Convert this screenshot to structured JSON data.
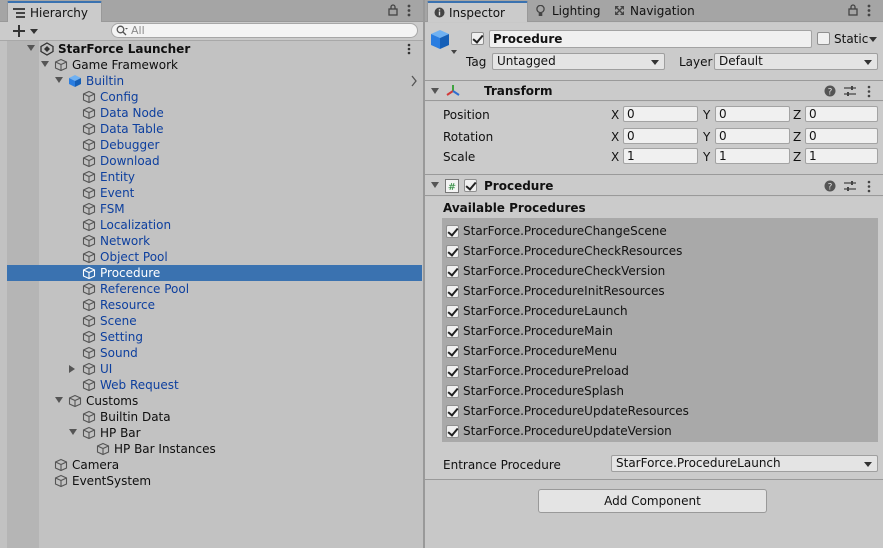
{
  "hierarchy": {
    "tab_label": "Hierarchy",
    "search_placeholder": "All",
    "rows": [
      {
        "label": "StarForce Launcher",
        "bold": true,
        "blue": false,
        "depth": 0,
        "expander": "down",
        "icon": "unity-scene-icon"
      },
      {
        "label": "Game Framework",
        "blue": false,
        "depth": 1,
        "expander": "down",
        "icon": "gameobject-icon"
      },
      {
        "label": "Builtin",
        "blue": true,
        "depth": 2,
        "expander": "down",
        "icon": "prefab-icon"
      },
      {
        "label": "Config",
        "blue": true,
        "depth": 3,
        "icon": "gameobject-icon"
      },
      {
        "label": "Data Node",
        "blue": true,
        "depth": 3,
        "icon": "gameobject-icon"
      },
      {
        "label": "Data Table",
        "blue": true,
        "depth": 3,
        "icon": "gameobject-icon"
      },
      {
        "label": "Debugger",
        "blue": true,
        "depth": 3,
        "icon": "gameobject-icon"
      },
      {
        "label": "Download",
        "blue": true,
        "depth": 3,
        "icon": "gameobject-icon"
      },
      {
        "label": "Entity",
        "blue": true,
        "depth": 3,
        "icon": "gameobject-icon"
      },
      {
        "label": "Event",
        "blue": true,
        "depth": 3,
        "icon": "gameobject-icon"
      },
      {
        "label": "FSM",
        "blue": true,
        "depth": 3,
        "icon": "gameobject-icon"
      },
      {
        "label": "Localization",
        "blue": true,
        "depth": 3,
        "icon": "gameobject-icon"
      },
      {
        "label": "Network",
        "blue": true,
        "depth": 3,
        "icon": "gameobject-icon"
      },
      {
        "label": "Object Pool",
        "blue": true,
        "depth": 3,
        "icon": "gameobject-icon"
      },
      {
        "label": "Procedure",
        "blue": true,
        "depth": 3,
        "icon": "gameobject-icon",
        "selected": true
      },
      {
        "label": "Reference Pool",
        "blue": true,
        "depth": 3,
        "icon": "gameobject-icon"
      },
      {
        "label": "Resource",
        "blue": true,
        "depth": 3,
        "icon": "gameobject-icon"
      },
      {
        "label": "Scene",
        "blue": true,
        "depth": 3,
        "icon": "gameobject-icon"
      },
      {
        "label": "Setting",
        "blue": true,
        "depth": 3,
        "icon": "gameobject-icon"
      },
      {
        "label": "Sound",
        "blue": true,
        "depth": 3,
        "icon": "gameobject-icon"
      },
      {
        "label": "UI",
        "blue": true,
        "depth": 3,
        "expander": "right",
        "icon": "gameobject-icon"
      },
      {
        "label": "Web Request",
        "blue": true,
        "depth": 3,
        "icon": "gameobject-icon"
      },
      {
        "label": "Customs",
        "blue": false,
        "depth": 2,
        "expander": "down",
        "icon": "gameobject-icon"
      },
      {
        "label": "Builtin Data",
        "blue": false,
        "depth": 3,
        "icon": "gameobject-icon"
      },
      {
        "label": "HP Bar",
        "blue": false,
        "depth": 3,
        "expander": "down",
        "icon": "gameobject-icon"
      },
      {
        "label": "HP Bar Instances",
        "blue": false,
        "depth": 4,
        "icon": "gameobject-icon"
      },
      {
        "label": "Camera",
        "blue": false,
        "depth": 1,
        "icon": "gameobject-icon"
      },
      {
        "label": "EventSystem",
        "blue": false,
        "depth": 1,
        "icon": "gameobject-icon"
      }
    ]
  },
  "inspector": {
    "tabs": [
      {
        "label": "Inspector",
        "icon": "info-icon"
      },
      {
        "label": "Lighting",
        "icon": "bulb-icon"
      },
      {
        "label": "Navigation",
        "icon": "navigation-icon"
      }
    ],
    "object": {
      "active": true,
      "name": "Procedure",
      "static_label": "Static",
      "static": false,
      "tag_label": "Tag",
      "tag_value": "Untagged",
      "layer_label": "Layer",
      "layer_value": "Default"
    },
    "transform": {
      "title": "Transform",
      "rows": [
        {
          "label": "Position",
          "x": "0",
          "y": "0",
          "z": "0"
        },
        {
          "label": "Rotation",
          "x": "0",
          "y": "0",
          "z": "0"
        },
        {
          "label": "Scale",
          "x": "1",
          "y": "1",
          "z": "1"
        }
      ],
      "axis_x": "X",
      "axis_y": "Y",
      "axis_z": "Z"
    },
    "procedure": {
      "title": "Procedure",
      "enabled": true,
      "available_label": "Available Procedures",
      "items": [
        "StarForce.ProcedureChangeScene",
        "StarForce.ProcedureCheckResources",
        "StarForce.ProcedureCheckVersion",
        "StarForce.ProcedureInitResources",
        "StarForce.ProcedureLaunch",
        "StarForce.ProcedureMain",
        "StarForce.ProcedureMenu",
        "StarForce.ProcedurePreload",
        "StarForce.ProcedureSplash",
        "StarForce.ProcedureUpdateResources",
        "StarForce.ProcedureUpdateVersion"
      ],
      "entrance_label": "Entrance Procedure",
      "entrance_value": "StarForce.ProcedureLaunch"
    },
    "add_component_label": "Add Component"
  },
  "colors": {
    "selection": "#3a72b0",
    "prefab_text": "#0d3f9e"
  }
}
